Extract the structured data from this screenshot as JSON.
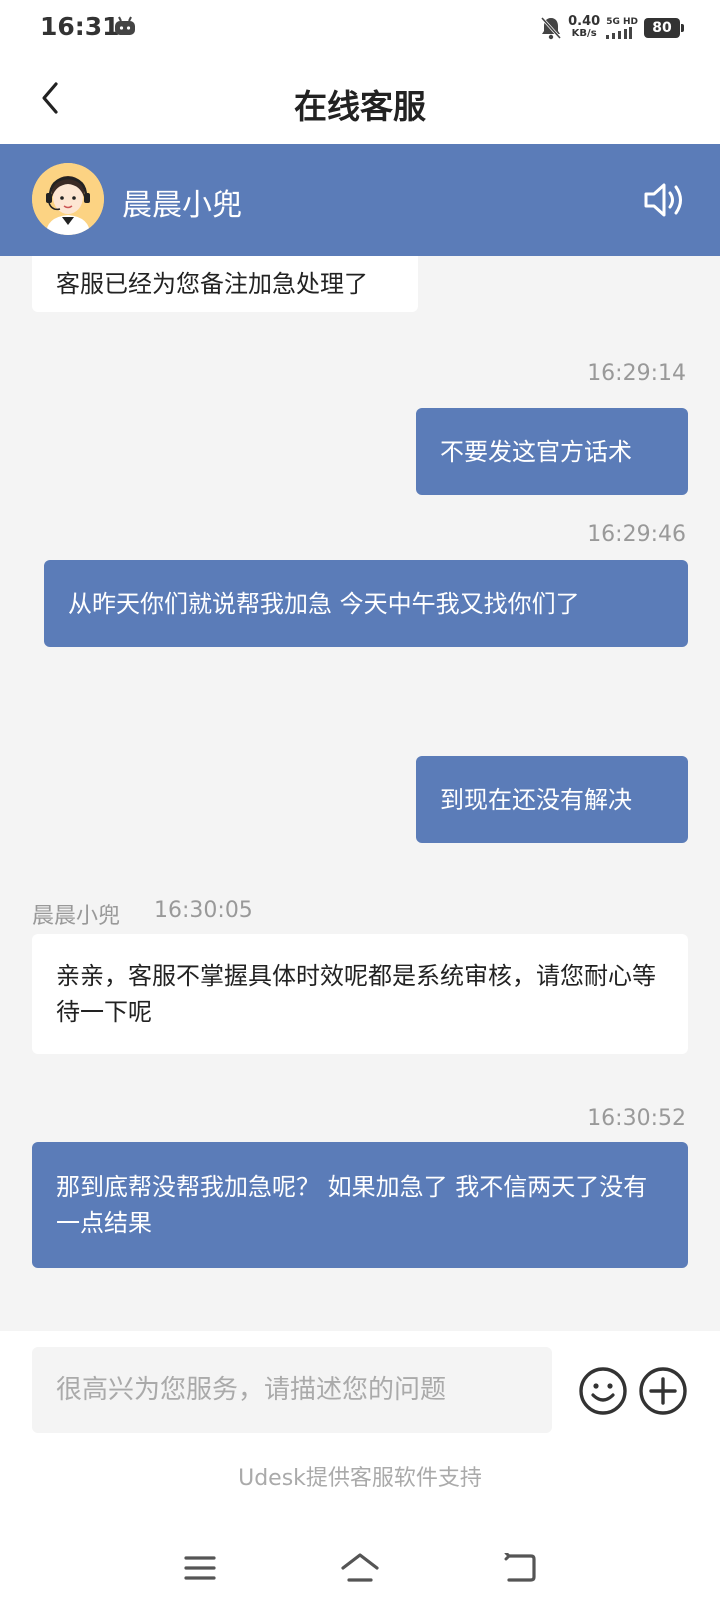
{
  "status_bar": {
    "time": "16:31",
    "net_speed_value": "0.40",
    "net_speed_unit": "KB/s",
    "network_label": "5G HD",
    "battery": "80"
  },
  "title_bar": {
    "title": "在线客服"
  },
  "agent": {
    "name": "晨晨小兜"
  },
  "messages": [
    {
      "from": "agent",
      "text": "客服已经为您备注加急处理了"
    },
    {
      "from": "user",
      "time": "16:29:14",
      "text": "不要发这官方话术"
    },
    {
      "from": "user",
      "time": "16:29:46",
      "text": "从昨天你们就说帮我加急 今天中午我又找你们了"
    },
    {
      "from": "user",
      "text": "到现在还没有解决"
    },
    {
      "from": "agent",
      "sender": "晨晨小兜",
      "time": "16:30:05",
      "text": "亲亲，客服不掌握具体时效呢都是系统审核，请您耐心等待一下呢"
    },
    {
      "from": "user",
      "time": "16:30:52",
      "text": "那到底帮没帮我加急呢？ 如果加急了 我不信两天了没有一点结果"
    }
  ],
  "input": {
    "placeholder": "很高兴为您服务，请描述您的问题",
    "value": ""
  },
  "footer": {
    "powered_by": "Udesk提供客服软件支持"
  },
  "colors": {
    "accent": "#5b7cb8",
    "chat_background": "#f4f4f4",
    "avatar_background": "#fcd383"
  },
  "icons": [
    "back-arrow-icon",
    "speaker-icon",
    "emoji-icon",
    "plus-icon",
    "menu-icon",
    "home-icon",
    "back-icon"
  ]
}
